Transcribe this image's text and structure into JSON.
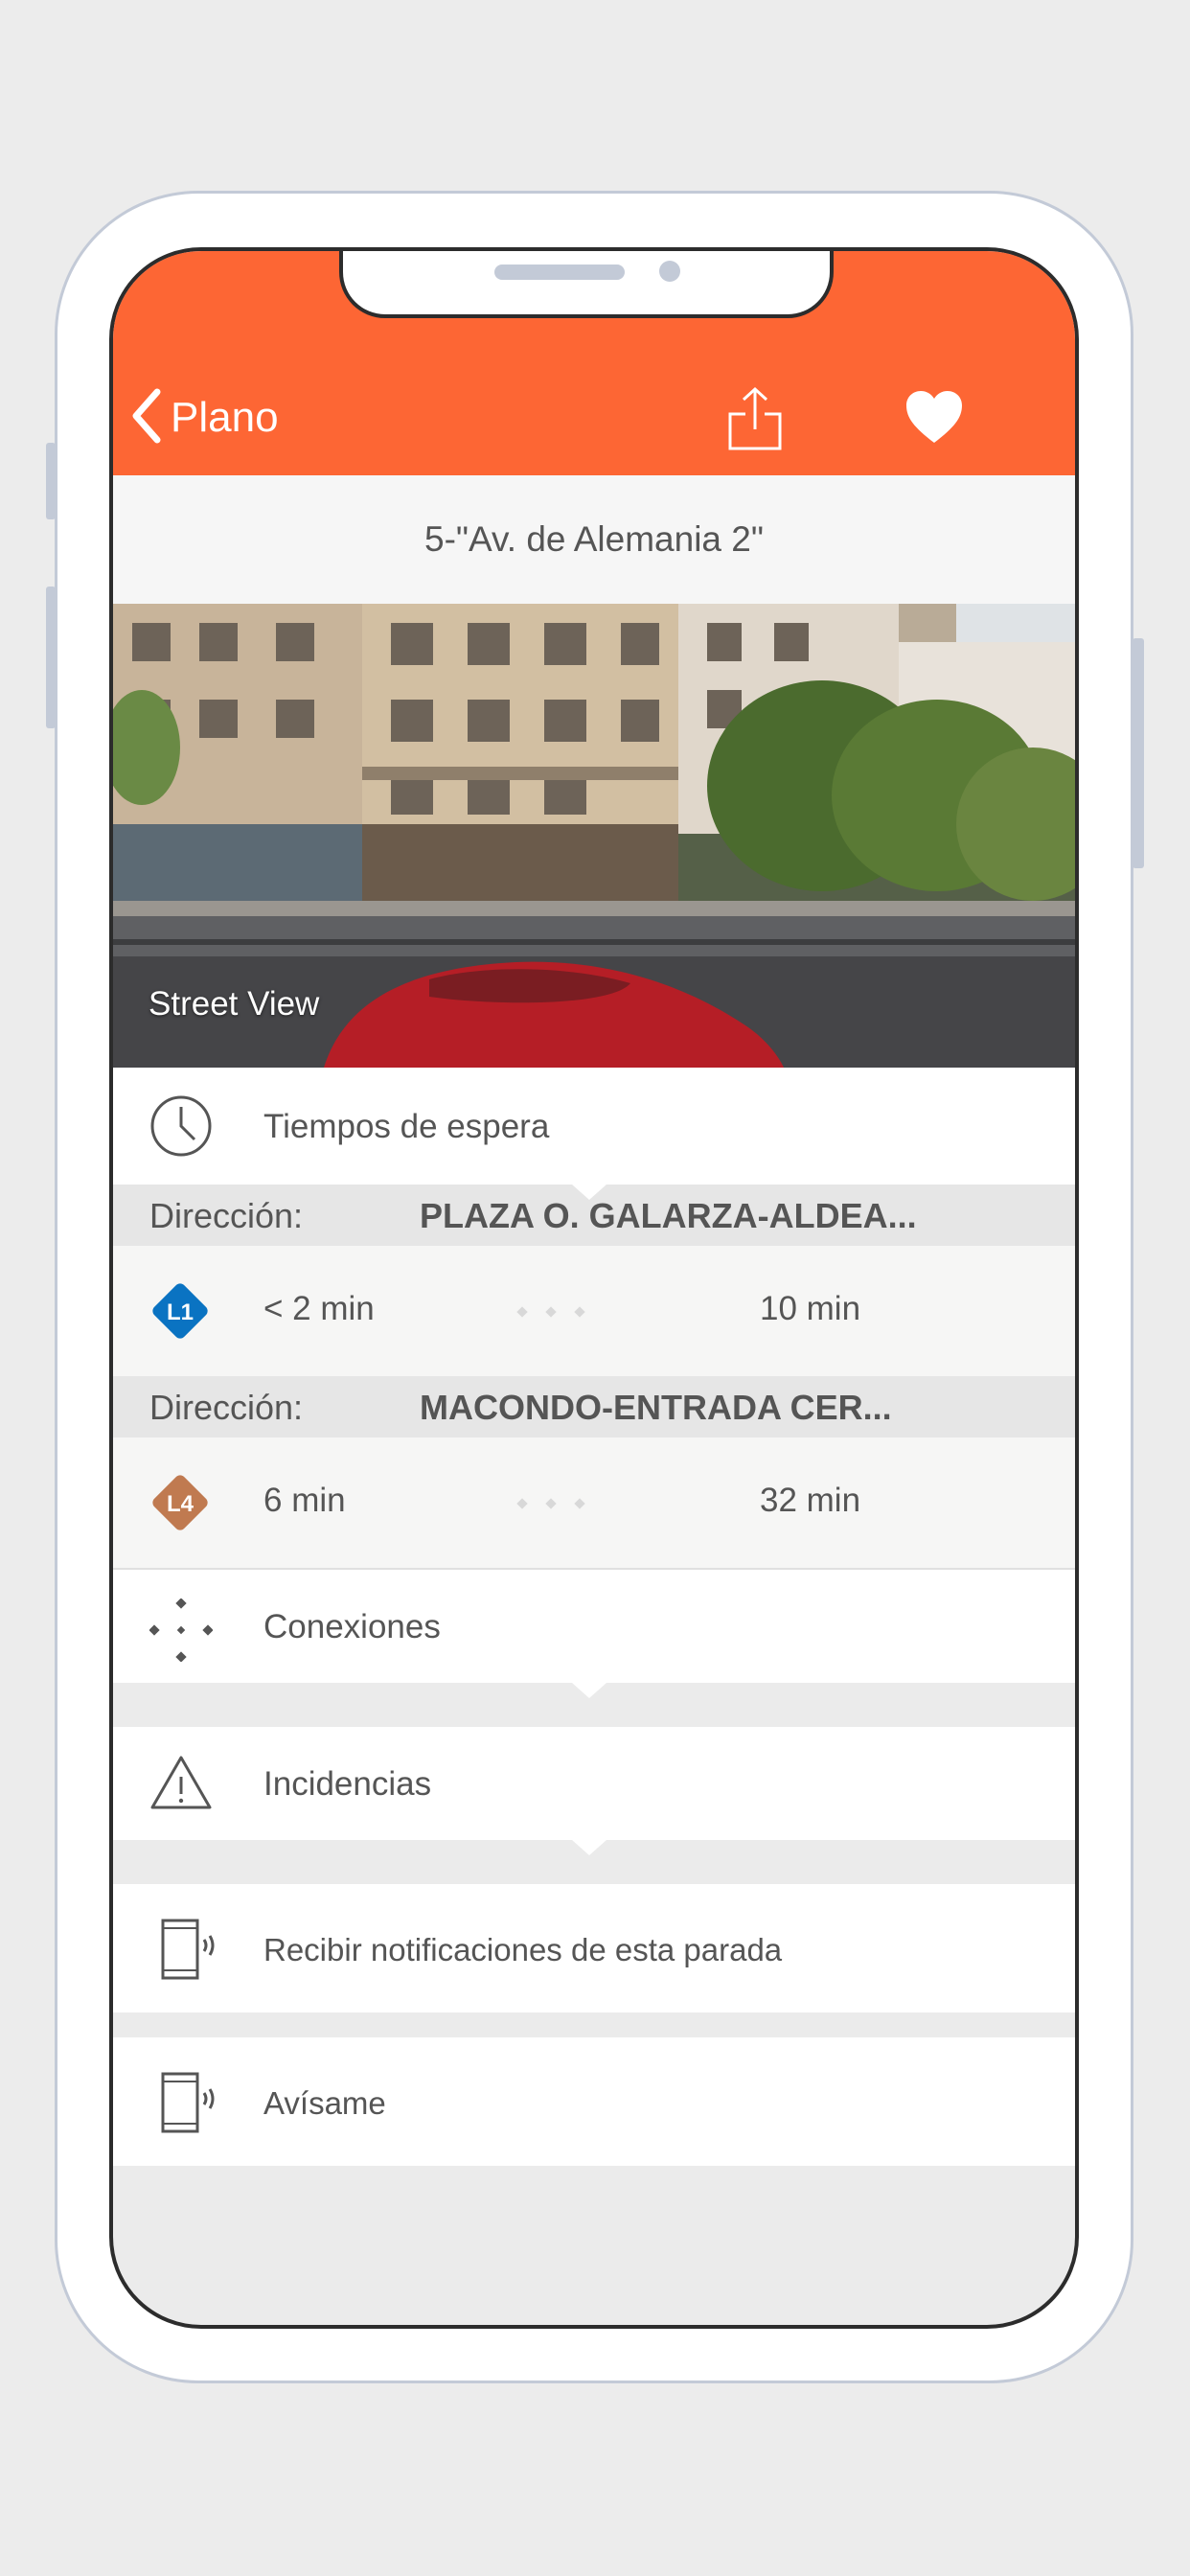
{
  "header": {
    "back_label": "Plano",
    "accent_color": "#fd6634"
  },
  "stop": {
    "title": "5-\"Av. de Alemania 2\""
  },
  "street_view": {
    "label": "Street View"
  },
  "waiting_times": {
    "label": "Tiempos de espera",
    "directions": [
      {
        "key": "Dirección:",
        "destination": "PLAZA O. GALARZA-ALDEA...",
        "line": "L1",
        "line_color": "#0a73c2",
        "next": "< 2 min",
        "following": "10 min"
      },
      {
        "key": "Dirección:",
        "destination": "MACONDO-ENTRADA CER...",
        "line": "L4",
        "line_color": "#c07a50",
        "next": "6 min",
        "following": "32 min"
      }
    ]
  },
  "menu": {
    "connections": "Conexiones",
    "incidents": "Incidencias",
    "notifications": "Recibir notificaciones de esta parada",
    "alert_me": "Avísame"
  }
}
